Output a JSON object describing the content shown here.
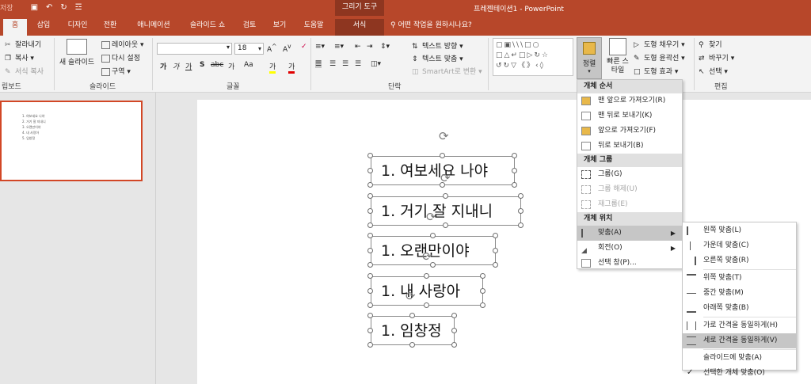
{
  "titlebar": {
    "save_label": "저장",
    "undo_icon": "↶",
    "redo_icon": "↻",
    "context_group": "그리기 도구",
    "doc_title": "프레젠테이션1 - PowerPoint"
  },
  "tabs": [
    "홈",
    "삽입",
    "디자인",
    "전환",
    "애니메이션",
    "슬라이드 쇼",
    "검토",
    "보기",
    "도움말",
    "서식"
  ],
  "tell_me": "어떤 작업을 원하시나요?",
  "ribbon": {
    "clipboard": {
      "cut": "잘라내기",
      "copy": "복사",
      "format_painter": "서식 복사",
      "label": "립보드"
    },
    "slides": {
      "new_slide": "새 슬라이드",
      "layout": "레이아웃",
      "reset": "다시 설정",
      "section": "구역",
      "label": "슬라이드"
    },
    "font": {
      "size": "18",
      "label": "글꼴",
      "btns": [
        "가",
        "가",
        "가",
        "S",
        "abc",
        "가",
        "Aa",
        "가",
        "가"
      ]
    },
    "paragraph": {
      "text_direction": "텍스트 방향",
      "align_text": "텍스트 맞춤",
      "smartart": "SmartArt로 변환",
      "label": "단락"
    },
    "drawing": {
      "arrange": "정렬",
      "quick_styles": "빠른 스타일",
      "fill": "도형 채우기",
      "outline": "도형 윤곽선",
      "effects": "도형 효과"
    },
    "editing": {
      "find": "찾기",
      "replace": "바꾸기",
      "select": "선택",
      "label": "편집"
    }
  },
  "slide_thumb_lines": [
    "1. 여보세요 나야",
    "2. 거기 잘 지내니",
    "3. 오랜만이야",
    "4. 내 사랑아",
    "5. 임창정"
  ],
  "textboxes": [
    "1.  여보세요 나야",
    "1.  거기 잘 지내니",
    "1.  오랜만이야",
    "1.  내 사랑아",
    "1. 임창정"
  ],
  "arrange_menu": {
    "order_header": "개체 순서",
    "order_items": [
      "맨 앞으로 가져오기(R)",
      "맨 뒤로 보내기(K)",
      "앞으로 가져오기(F)",
      "뒤로 보내기(B)"
    ],
    "group_header": "개체 그룹",
    "group_items": [
      "그룹(G)",
      "그룹 해제(U)",
      "재그룹(E)"
    ],
    "position_header": "개체 위치",
    "position_items": [
      "맞춤(A)",
      "회전(O)",
      "선택 창(P)..."
    ]
  },
  "align_menu": {
    "items": [
      "왼쪽 맞춤(L)",
      "가운데 맞춤(C)",
      "오른쪽 맞춤(R)",
      "위쪽 맞춤(T)",
      "중간 맞춤(M)",
      "아래쪽 맞춤(B)",
      "가로 간격을 동일하게(H)",
      "세로 간격을 동일하게(V)",
      "슬라이드에 맞춤(A)",
      "선택한 개체 맞춤(O)"
    ]
  },
  "colors": {
    "accent": "#b7472a",
    "accent_dark": "#8e3620",
    "menu_highlight": "#c6c6c6"
  }
}
